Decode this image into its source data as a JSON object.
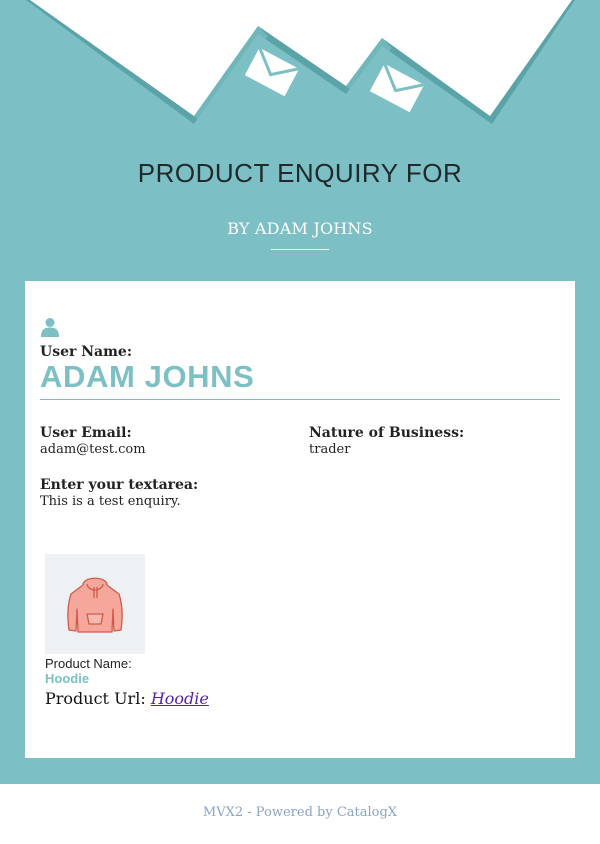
{
  "header": {
    "title": "PRODUCT ENQUIRY FOR",
    "subtitle": "BY ADAM JOHNS"
  },
  "colors": {
    "teal": "#7cc0c5",
    "white": "#ffffff",
    "footer_text": "#8aa4c4",
    "link": "#5522aa"
  },
  "icons": {
    "header_envelopes": [
      "envelope-icon",
      "envelope-icon"
    ],
    "user": "user-icon",
    "product_image": "hoodie-image"
  },
  "user": {
    "name_label": "User Name:",
    "name": "ADAM JOHNS",
    "email_label": "User Email:",
    "email": "adam@test.com",
    "business_label": "Nature of Business:",
    "business": "trader",
    "textarea_label": "Enter your textarea:",
    "textarea": "This is a test enquiry."
  },
  "product": {
    "name_label": "Product Name:",
    "name": "Hoodie",
    "url_label": "Product Url:",
    "url_text": "Hoodie"
  },
  "footer": {
    "text": "MVX2 - Powered by CatalogX"
  }
}
